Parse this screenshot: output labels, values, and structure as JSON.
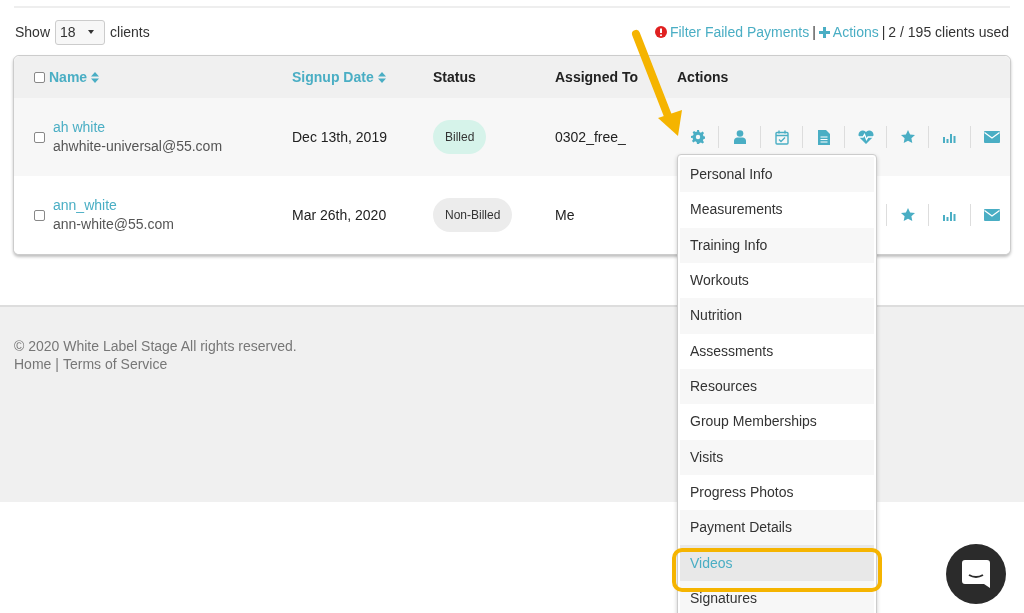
{
  "toolbar": {
    "show_label": "Show",
    "page_size": "18",
    "clients_label": "clients",
    "filter_link": "Filter Failed Payments",
    "separator_1": "|",
    "actions_link": "Actions",
    "separator_2": "|",
    "usage": "2 / 195 clients used"
  },
  "table": {
    "select_all_checked": false,
    "columns": [
      {
        "label": "Name",
        "sortable": true
      },
      {
        "label": "Signup Date",
        "sortable": true
      },
      {
        "label": "Status",
        "sortable": false
      },
      {
        "label": "Assigned To",
        "sortable": false
      },
      {
        "label": "Actions",
        "sortable": false
      }
    ],
    "rows": [
      {
        "name": "ah white",
        "email": "ahwhite-universal@55.com",
        "signup": "Dec 13th, 2019",
        "status": "Billed",
        "billed": true,
        "assigned": "0302_free_",
        "checked": false
      },
      {
        "name": "ann_white",
        "email": "ann-white@55.com",
        "signup": "Mar 26th, 2020",
        "status": "Non-Billed",
        "billed": false,
        "assigned": "Me",
        "checked": false
      }
    ]
  },
  "actions_menu": {
    "items": [
      {
        "label": "Personal Info",
        "selected": false
      },
      {
        "label": "Measurements",
        "selected": false
      },
      {
        "label": "Training Info",
        "selected": false
      },
      {
        "label": "Workouts",
        "selected": false
      },
      {
        "label": "Nutrition",
        "selected": false
      },
      {
        "label": "Assessments",
        "selected": false
      },
      {
        "label": "Resources",
        "selected": false
      },
      {
        "label": "Group Memberships",
        "selected": false
      },
      {
        "label": "Visits",
        "selected": false
      },
      {
        "label": "Progress Photos",
        "selected": false
      },
      {
        "label": "Payment Details",
        "selected": false
      },
      {
        "label": "Videos",
        "selected": true
      },
      {
        "label": "Signatures",
        "selected": false
      }
    ]
  },
  "footer": {
    "copyright": "© 2020 White Label Stage All rights reserved.",
    "home_link": "Home",
    "separator": "|",
    "terms_link": "Terms of Service"
  }
}
